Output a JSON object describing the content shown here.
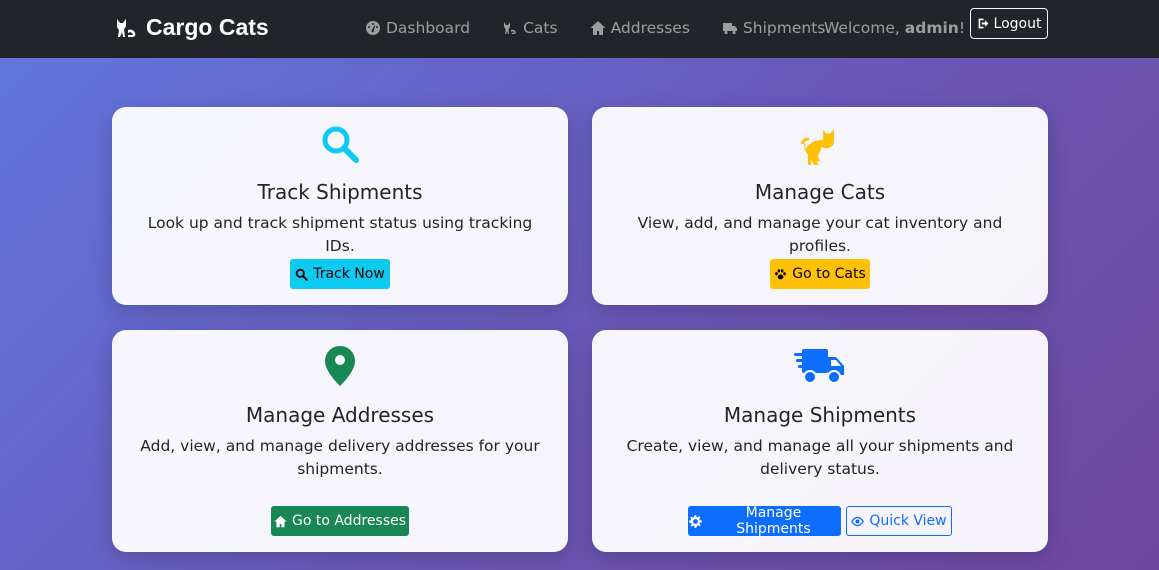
{
  "navbar": {
    "brand": "Cargo Cats",
    "links": [
      {
        "label": "Dashboard",
        "icon": "dashboard-icon"
      },
      {
        "label": "Cats",
        "icon": "cat-icon"
      },
      {
        "label": "Addresses",
        "icon": "home-icon"
      },
      {
        "label": "Shipments",
        "icon": "truck-icon"
      }
    ],
    "welcome_prefix": "Welcome, ",
    "username": "admin",
    "welcome_suffix": "!",
    "logout_label": "Logout"
  },
  "cards": {
    "track": {
      "title": "Track Shipments",
      "description": "Look up and track shipment status using tracking IDs.",
      "button": "Track Now",
      "icon": "search-icon",
      "accent": "#0dcaf0"
    },
    "cats": {
      "title": "Manage Cats",
      "description": "View, add, and manage your cat inventory and profiles.",
      "button": "Go to Cats",
      "icon": "cat-icon",
      "accent": "#ffc107"
    },
    "addresses": {
      "title": "Manage Addresses",
      "description": "Add, view, and manage delivery addresses for your shipments.",
      "button": "Go to Addresses",
      "icon": "map-pin-icon",
      "accent": "#198754"
    },
    "shipments": {
      "title": "Manage Shipments",
      "description": "Create, view, and manage all your shipments and delivery status.",
      "button_primary": "Manage Shipments",
      "button_secondary": "Quick View",
      "icon": "shipping-fast-icon",
      "accent": "#0d6efd"
    }
  }
}
